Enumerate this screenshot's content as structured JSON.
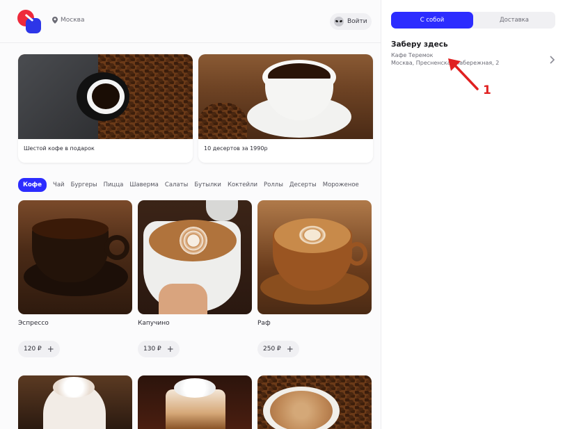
{
  "header": {
    "location": "Москва",
    "login_label": "Войти"
  },
  "promos": [
    {
      "caption": "Шестой кофе в подарок"
    },
    {
      "caption": "10 десертов за 1990р"
    }
  ],
  "categories": [
    "Кофе",
    "Чай",
    "Бургеры",
    "Пицца",
    "Шаверма",
    "Салаты",
    "Бутылки",
    "Коктейли",
    "Роллы",
    "Десерты",
    "Мороженое"
  ],
  "active_category": "Кофе",
  "products": [
    {
      "name": "Эспрессо",
      "price": "120 ₽"
    },
    {
      "name": "Капучино",
      "price": "130 ₽"
    },
    {
      "name": "Раф",
      "price": "250 ₽"
    }
  ],
  "sidebar": {
    "tabs": [
      "С собой",
      "Доставка"
    ],
    "active_tab": "С собой",
    "pickup_title": "Заберу здесь",
    "place": "Кафе Теремок",
    "address": "Москва, Пресненская набережная, 2"
  },
  "annotation": {
    "label": "1",
    "color": "#e02020"
  },
  "colors": {
    "accent": "#2c2cff",
    "logo_red": "#ee2a3c",
    "logo_blue": "#2d36e8"
  }
}
